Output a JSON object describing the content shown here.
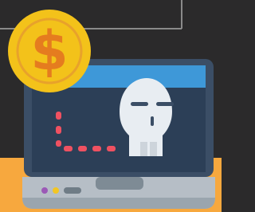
{
  "illustration": {
    "subject": "laptop-skull-dollar-coin",
    "coin_symbol": "$",
    "colors": {
      "background": "#2b2a2b",
      "grid_line": "#8a8a8a",
      "desk": "#f7a83e",
      "laptop_frame": "#3b4e66",
      "screen": "#2c3f57",
      "title_bar": "#3e98d8",
      "skull": "#e8edf2",
      "skull_shadow": "#cdd4db",
      "skull_features": "#3b4e66",
      "dotted_path": "#ef5161",
      "laptop_base": "#b6bec6",
      "laptop_base_dark": "#7e8b95",
      "led_purple": "#9b59b6",
      "led_yellow": "#f3c623",
      "slot": "#6f7c86",
      "coin": "#f3c21a",
      "coin_ring": "#e8a22b",
      "dollar": "#e57c1f"
    }
  }
}
